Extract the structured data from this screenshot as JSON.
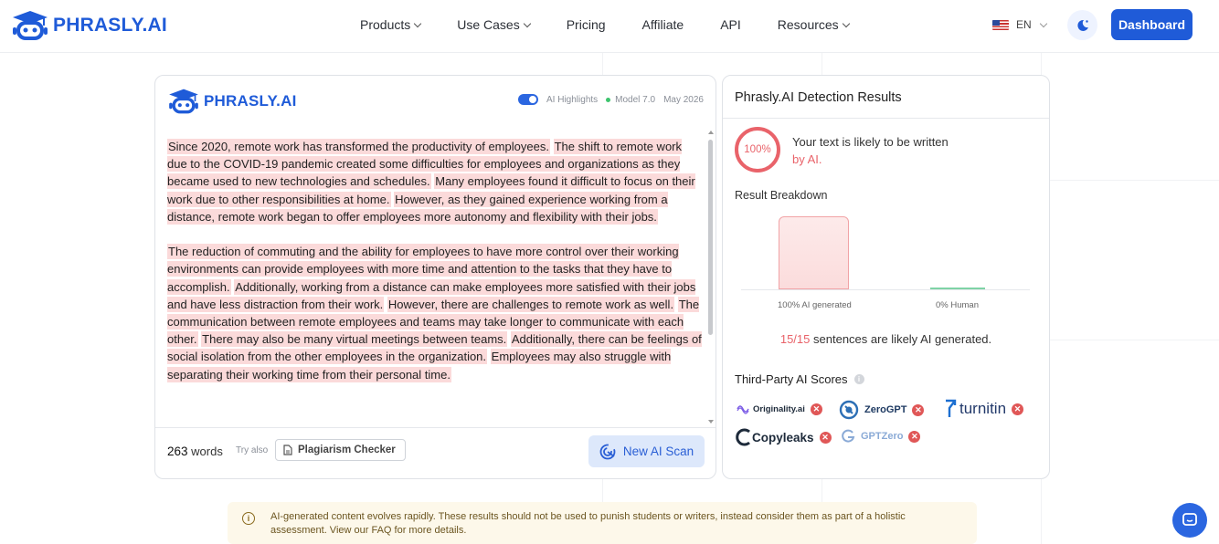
{
  "nav": {
    "brand": "PHRASLY.AI",
    "links": [
      {
        "label": "Products",
        "has_dropdown": true
      },
      {
        "label": "Use Cases",
        "has_dropdown": true
      },
      {
        "label": "Pricing",
        "has_dropdown": false
      },
      {
        "label": "Affiliate",
        "has_dropdown": false
      },
      {
        "label": "API",
        "has_dropdown": false
      },
      {
        "label": "Resources",
        "has_dropdown": true
      }
    ],
    "language": "EN",
    "dashboard_label": "Dashboard",
    "accent_color": "#1f5bd8"
  },
  "editor": {
    "brand": "PHRASLY.AI",
    "ai_highlights_label": "AI Highlights",
    "ai_highlights_on": true,
    "model_label": "Model 7.0",
    "date_label": "May 2026",
    "paragraphs": [
      [
        "Since 2020, remote work has transformed the productivity of employees.",
        "The shift to remote work due to the COVID-19 pandemic created some difficulties for employees and organizations as they became used to new technologies and schedules.",
        "Many employees found it difficult to focus on their work due to other responsibilities at home.",
        "However, as they gained experience working from a distance, remote work began to offer employees more autonomy and flexibility with their jobs."
      ],
      [
        "The reduction of commuting and the ability for employees to have more control over their working environments can provide employees with more time and attention to the tasks that they have to accomplish.",
        "Additionally, working from a distance can make employees more satisfied with their jobs and have less distraction from their work.",
        "However, there are challenges to remote work as well.",
        "The communication between remote employees and teams may take longer to communicate with each other.",
        "There may also be many virtual meetings between teams.",
        "Additionally, there can be feelings of social isolation from the other employees in the organization.",
        "Employees may also struggle with separating their working time from their personal time."
      ]
    ],
    "highlight_color": "#fbdada",
    "word_count": "263",
    "words_label": "words",
    "try_also_label": "Try also",
    "plagiarism_label": "Plagiarism Checker",
    "scan_label": "New AI Scan"
  },
  "results": {
    "title": "Phrasly.AI Detection Results",
    "score_label": "100%",
    "verdict_line1": "Your text is likely to be written",
    "verdict_line2": "by AI.",
    "breakdown_label": "Result Breakdown",
    "ai_percent": 100,
    "human_percent": 0,
    "ai_bar_label": "100% AI generated",
    "human_bar_label": "0% Human",
    "sentences_count": "15/15",
    "sentences_mid": "sentences are likely",
    "sentences_end": "AI generated.",
    "third_party_label": "Third-Party AI Scores",
    "third_party": [
      {
        "name": "Originality.ai",
        "icon": "originality-logo"
      },
      {
        "name": "ZeroGPT",
        "icon": "zerogpt-logo"
      },
      {
        "name": "turnitin",
        "icon": "turnitin-logo"
      },
      {
        "name": "Copyleaks",
        "icon": "copyleaks-logo"
      },
      {
        "name": "GPTZero",
        "icon": "gptzero-logo"
      }
    ],
    "danger_color": "#e9636a"
  },
  "notice": {
    "text": "AI-generated content evolves rapidly. These results should not be used to punish students or writers, instead consider them as part of a holistic assessment. View our FAQ for more details."
  }
}
